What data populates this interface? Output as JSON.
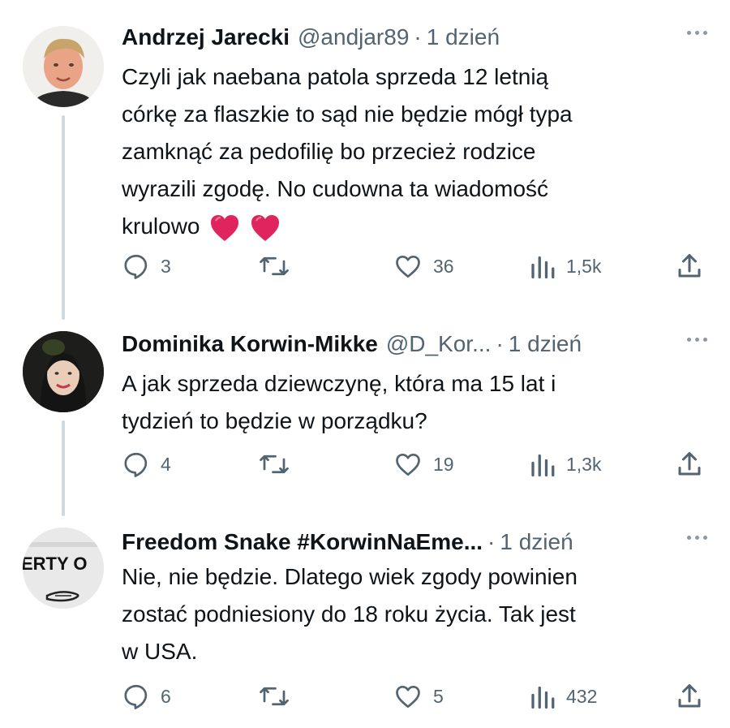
{
  "tweets": [
    {
      "name": "Andrzej Jarecki",
      "handle": "@andjar89",
      "dot": "·",
      "time": "1 dzień",
      "lines": [
        "Czyli jak naebana patola sprzeda 12 letnią",
        "córkę za flaszkie to sąd nie będzie mógł typa",
        "zamknąć za pedofilię bo przecież rodzice",
        "wyrazili zgodę. No cudowna ta wiadomość",
        "krulowo"
      ],
      "emoji": [
        "heart-emoji",
        "heart-emoji"
      ],
      "replies": "3",
      "retweets": "",
      "likes": "36",
      "views": "1,5k"
    },
    {
      "name": "Dominika Korwin-Mikke",
      "handle": "@D_Kor...",
      "dot": "·",
      "time": "1 dzień",
      "lines": [
        "A jak sprzeda dziewczynę, która ma 15 lat i",
        "tydzień to będzie w porządku?"
      ],
      "replies": "4",
      "retweets": "",
      "likes": "19",
      "views": "1,3k"
    },
    {
      "name": "Freedom Snake #KorwinNaEme...",
      "handle": "",
      "dot": "·",
      "time": "1 dzień",
      "lines": [
        "Nie, nie będzie. Dlatego wiek zgody powinien",
        "zostać podniesiony do 18 roku życia. Tak jest",
        "w USA."
      ],
      "avatar_text": "ERTY O",
      "replies": "6",
      "retweets": "",
      "likes": "5",
      "views": "432"
    }
  ],
  "colors": {
    "text": "#0f1419",
    "secondary": "#536471",
    "thread_line": "#cfd9de",
    "heart": "#e0245e"
  },
  "icons": [
    "reply-icon",
    "retweet-icon",
    "like-icon",
    "views-icon",
    "share-icon",
    "more-icon"
  ]
}
